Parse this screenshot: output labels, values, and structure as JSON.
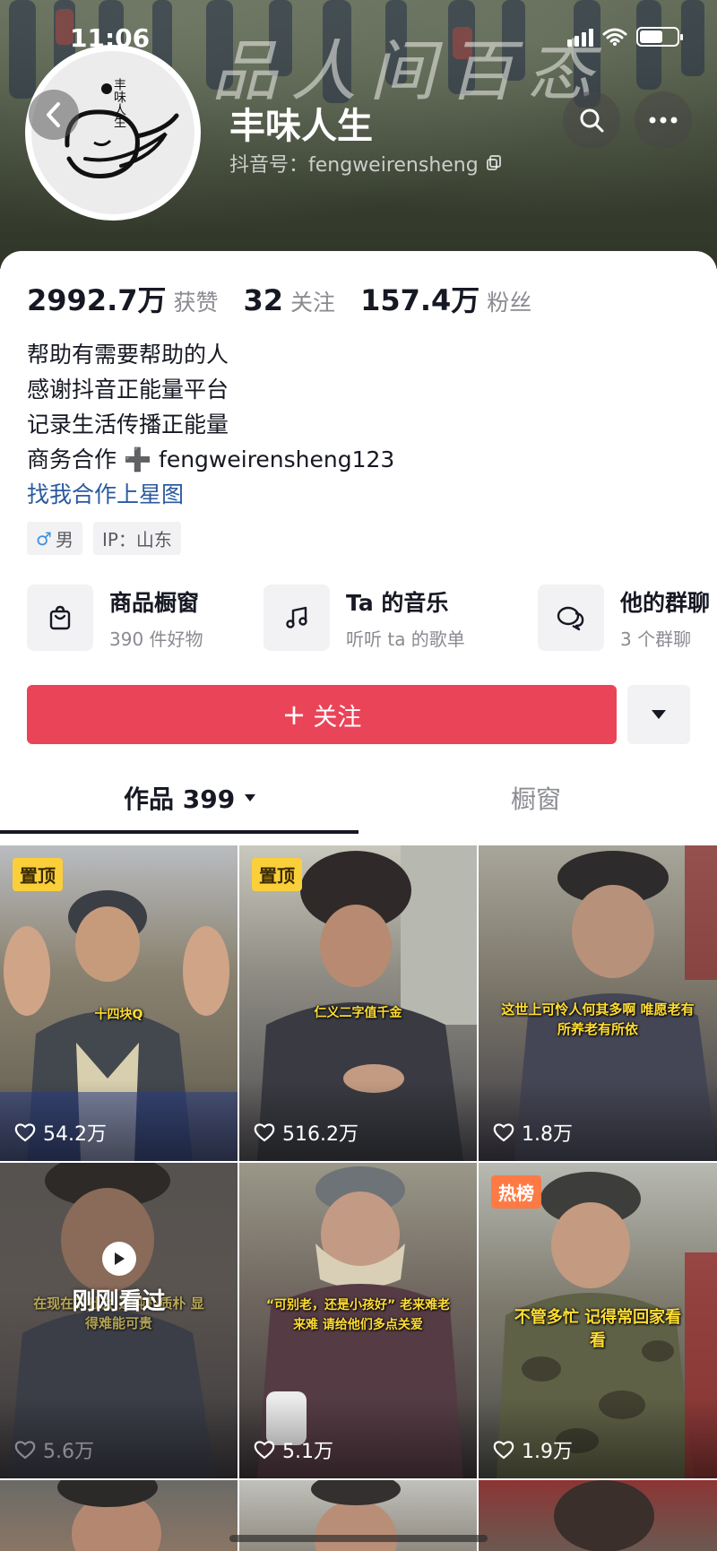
{
  "status_bar": {
    "time": "11:06"
  },
  "header": {
    "banner_caption": "品人间百态",
    "name": "丰味人生",
    "douyin_id": "抖音号：fengweirensheng",
    "avatar_text": "丰味人生"
  },
  "stats": [
    {
      "value": "2992.7万",
      "label": "获赞"
    },
    {
      "value": "32",
      "label": "关注"
    },
    {
      "value": "157.4万",
      "label": "粉丝"
    }
  ],
  "bio": {
    "lines": [
      "帮助有需要帮助的人",
      "感谢抖音正能量平台",
      "记录生活传播正能量",
      "商务合作 ➕ fengweirensheng123"
    ],
    "link": "找我合作上星图"
  },
  "tags": {
    "gender_symbol": "♂",
    "gender": "男",
    "ip": "IP：山东"
  },
  "features": [
    {
      "title": "商品橱窗",
      "subtitle": "390 件好物",
      "icon": "shopping-bag-icon"
    },
    {
      "title": "Ta 的音乐",
      "subtitle": "听听 ta 的歌单",
      "icon": "music-note-icon"
    },
    {
      "title": "他的群聊",
      "subtitle": "3 个群聊",
      "icon": "chat-bubble-icon"
    }
  ],
  "follow_button": {
    "label": "关注"
  },
  "tabs": {
    "works": "作品 399",
    "shop": "橱窗"
  },
  "videos": [
    {
      "badge": "置顶",
      "badge_type": "pin",
      "likes": "54.2万",
      "caption": "十四块Q"
    },
    {
      "badge": "置顶",
      "badge_type": "pin",
      "likes": "516.2万",
      "caption": "仁义二字值千金"
    },
    {
      "badge": "",
      "badge_type": "",
      "likes": "1.8万",
      "caption": "这世上可怜人何其多啊 唯愿老有所养老有所依"
    },
    {
      "badge": "",
      "badge_type": "",
      "likes": "5.6万",
      "caption": "在现在的社会 这纯朴质朴 显得难能可贵",
      "watched": "刚刚看过"
    },
    {
      "badge": "",
      "badge_type": "",
      "likes": "5.1万",
      "caption": "“可别老，还是小孩好” 老来难老来难 请给他们多点关爱"
    },
    {
      "badge": "热榜",
      "badge_type": "hot",
      "likes": "1.9万",
      "caption": "不管多忙 记得常回家看看"
    }
  ],
  "colors": {
    "accent": "#ea4458",
    "link": "#2a5aa0",
    "pin_badge": "#facf3a",
    "hot_badge": "#fe7a45"
  }
}
